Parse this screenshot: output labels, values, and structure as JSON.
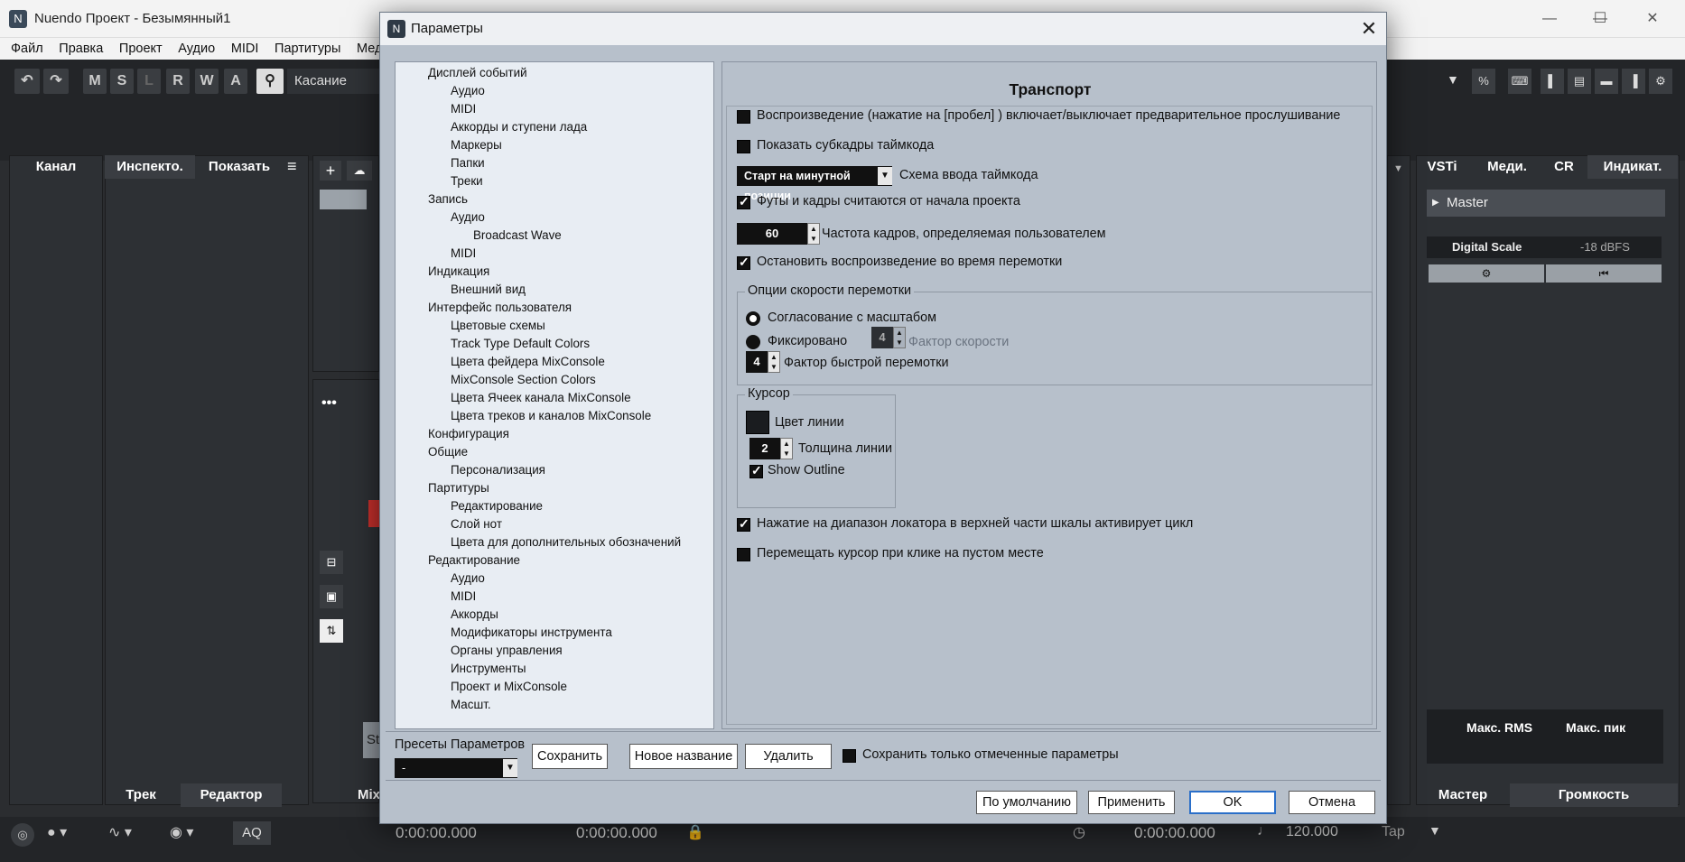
{
  "app": {
    "title": "Nuendo Проект - Безымянный1",
    "menu": [
      "Файл",
      "Правка",
      "Проект",
      "Аудио",
      "MIDI",
      "Партитуры",
      "Мед"
    ],
    "toolbar": {
      "buttons": [
        "M",
        "S",
        "L",
        "R",
        "W",
        "A"
      ],
      "mode": "Касание"
    },
    "left_tabs": [
      "Канал",
      "Инспекто.",
      "Показать"
    ],
    "left_bottom_tabs": [
      "Трек",
      "Редактор"
    ],
    "mid_bottom_tab": "Mix",
    "right_tabs": [
      "VSTi",
      "Меди.",
      "CR",
      "Индикат."
    ],
    "right_panel": {
      "master": "Master",
      "digital_scale": "Digital Scale",
      "dbfs": "-18 dBFS",
      "rms": "Макс. RMS",
      "peak": "Макс. пик"
    },
    "right_bottom_tabs": [
      "Мастер",
      "Громкость"
    ],
    "transport": {
      "time1": "0:00:00.000",
      "time2": "0:00:00.000",
      "time3": "0:00:00.000",
      "tempo": "120.000",
      "tap": "Tap",
      "aq": "AQ"
    },
    "st_label": "St"
  },
  "dialog": {
    "title": "Параметры",
    "tree": [
      {
        "label": "Дисплей событий",
        "level": 1
      },
      {
        "label": "Аудио",
        "level": 2
      },
      {
        "label": "MIDI",
        "level": 2
      },
      {
        "label": "Аккорды и ступени лада",
        "level": 2
      },
      {
        "label": "Маркеры",
        "level": 2
      },
      {
        "label": "Папки",
        "level": 2
      },
      {
        "label": "Треки",
        "level": 2
      },
      {
        "label": "Запись",
        "level": 1
      },
      {
        "label": "Аудио",
        "level": 2
      },
      {
        "label": "Broadcast Wave",
        "level": 3
      },
      {
        "label": "MIDI",
        "level": 2
      },
      {
        "label": "Индикация",
        "level": 1
      },
      {
        "label": "Внешний вид",
        "level": 2
      },
      {
        "label": "Интерфейс пользователя",
        "level": 1
      },
      {
        "label": "Цветовые схемы",
        "level": 2
      },
      {
        "label": "Track Type Default Colors",
        "level": 2
      },
      {
        "label": "Цвета фейдера MixConsole",
        "level": 2
      },
      {
        "label": "MixConsole Section Colors",
        "level": 2
      },
      {
        "label": "Цвета Ячеек канала MixConsole",
        "level": 2
      },
      {
        "label": "Цвета треков и каналов MixConsole",
        "level": 2
      },
      {
        "label": "Конфигурация",
        "level": 1
      },
      {
        "label": "Общие",
        "level": 1
      },
      {
        "label": "Персонализация",
        "level": 2
      },
      {
        "label": "Партитуры",
        "level": 1
      },
      {
        "label": "Редактирование",
        "level": 2
      },
      {
        "label": "Слой нот",
        "level": 2
      },
      {
        "label": "Цвета для дополнительных обозначений",
        "level": 2
      },
      {
        "label": "Редактирование",
        "level": 1
      },
      {
        "label": "Аудио",
        "level": 2
      },
      {
        "label": "MIDI",
        "level": 2
      },
      {
        "label": "Аккорды",
        "level": 2
      },
      {
        "label": "Модификаторы инструмента",
        "level": 2
      },
      {
        "label": "Органы управления",
        "level": 2
      },
      {
        "label": "Инструменты",
        "level": 2
      },
      {
        "label": "Проект и MixConsole",
        "level": 2
      },
      {
        "label": "Масшт.",
        "level": 2
      }
    ],
    "transport": {
      "title": "Транспорт",
      "opt_preview": "Воспроизведение (нажатие на [пробел] ) включает/выключает предварительное прослушивание",
      "opt_subframes": "Показать субкадры таймкода",
      "timecode_mode": "Старт на минутной позиции",
      "timecode_label": "Схема ввода таймкода",
      "opt_feet": "Футы и кадры считаются от начала проекта",
      "fps_value": "60",
      "fps_label": "Частота кадров, определяемая пользователем",
      "opt_stop": "Остановить воспроизведение во время перемотки",
      "wind_group": "Опции скорости перемотки",
      "wind_zoom": "Согласование с масштабом",
      "wind_fixed": "Фиксировано",
      "speed_value": "4",
      "speed_label": "Фактор скорости",
      "fast_value": "4",
      "fast_label": "Фактор быстрой перемотки",
      "cursor_group": "Курсор",
      "line_color": "Цвет линии",
      "line_width_value": "2",
      "line_width": "Толщина линии",
      "show_outline": "Show Outline",
      "opt_cycle": "Нажатие на диапазон локатора в верхней части шкалы активирует цикл",
      "opt_move_cursor": "Перемещать курсор при клике на пустом месте"
    },
    "presets": {
      "label": "Пресеты Параметров",
      "value": "-",
      "save": "Сохранить",
      "rename": "Новое название",
      "delete": "Удалить",
      "only_checked": "Сохранить только отмеченные параметры"
    },
    "buttons": {
      "default": "По умолчанию",
      "apply": "Применить",
      "ok": "OK",
      "cancel": "Отмена"
    }
  }
}
